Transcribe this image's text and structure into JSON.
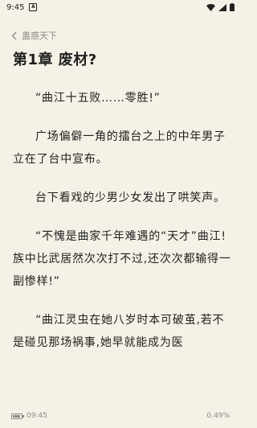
{
  "status_bar": {
    "time": "9:45",
    "notif_glyph": "A",
    "icons": [
      "wifi-icon",
      "signal-icon",
      "battery-icon"
    ]
  },
  "nav": {
    "back_label": "蛊惑天下",
    "back_icon": "chevron-left-icon"
  },
  "chapter": {
    "title": "第1章  废材?"
  },
  "paragraphs": [
    "“曲江十五败……零胜!”",
    "广场偏僻一角的擂台之上的中年男子立在了台中宣布。",
    "台下看戏的少男少女发出了哄笑声。",
    "“不愧是曲家千年难遇的“天才”曲江!族中比武居然次次打不过,还次次都输得一副惨样!”",
    "“曲江灵虫在她八岁时本可破茧,若不是碰见那场祸事,她早就能成为医"
  ],
  "footer": {
    "battery_level": 0.85,
    "time": "09:45",
    "progress": "0.49%"
  },
  "colors": {
    "background": "#f5f1e6",
    "text": "#1f1f1f",
    "muted": "#8c8a84"
  }
}
